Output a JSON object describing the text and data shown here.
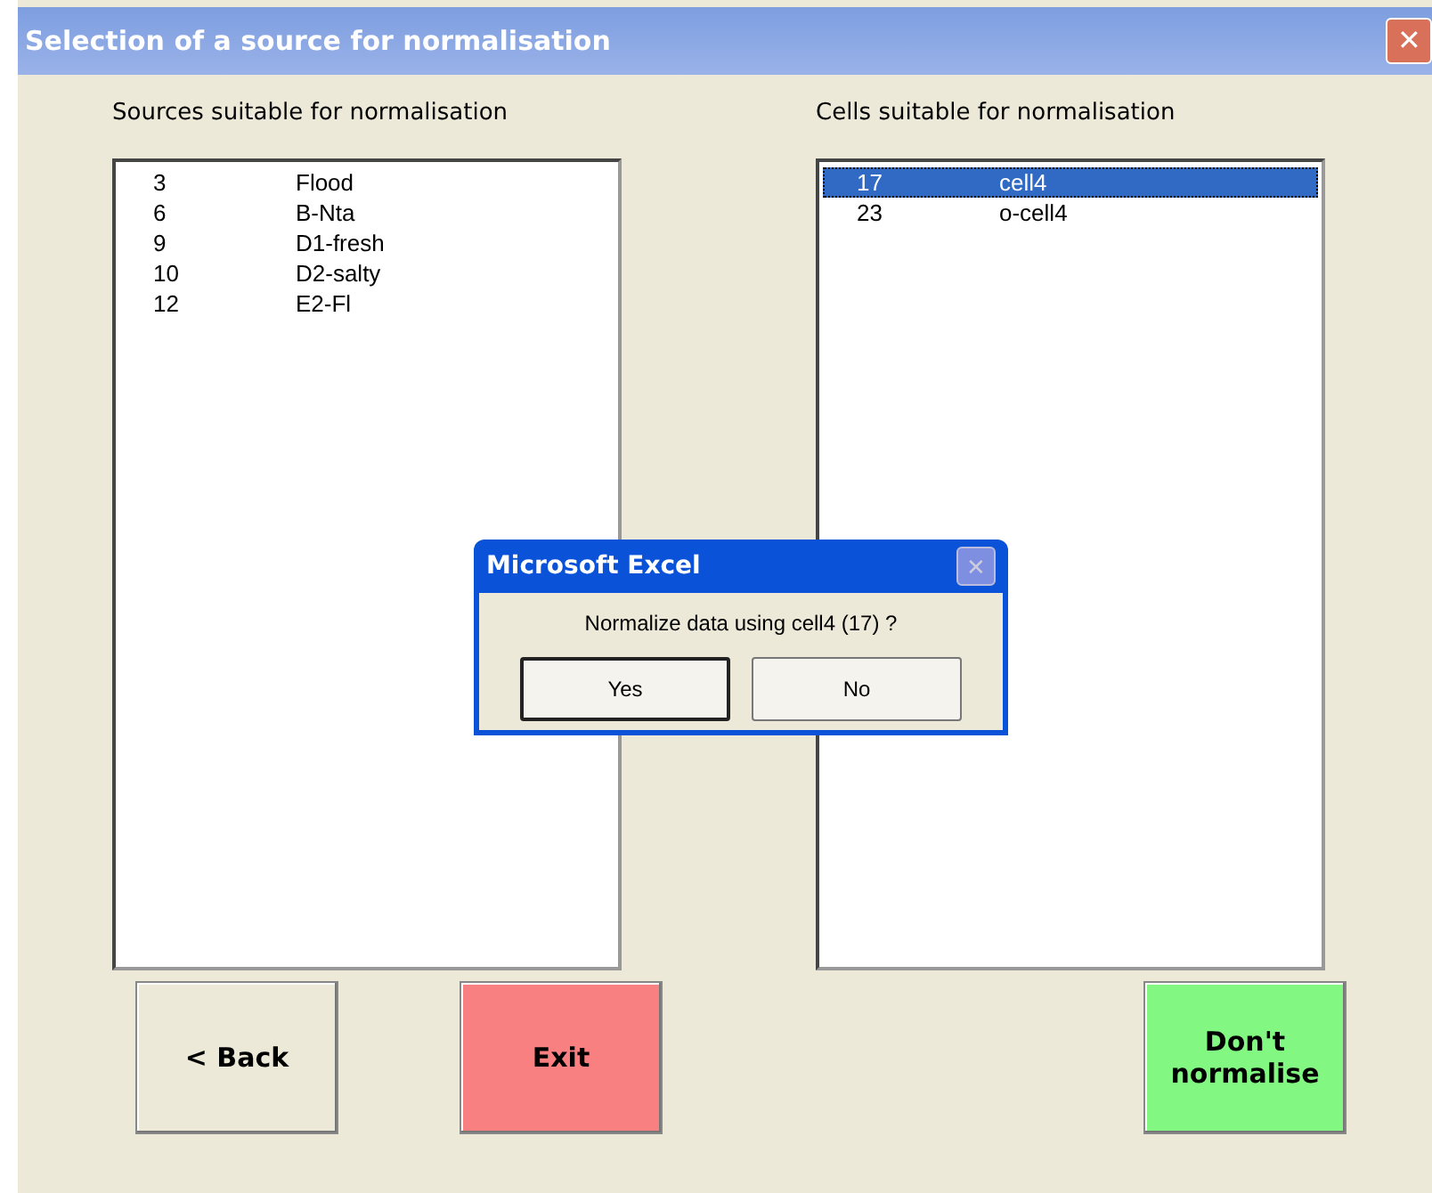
{
  "window": {
    "title": "Selection of a source for normalisation",
    "close": "✕"
  },
  "sources": {
    "label": "Sources suitable for normalisation",
    "rows": [
      {
        "id": "3",
        "name": "Flood",
        "selected": false
      },
      {
        "id": "6",
        "name": "B-Nta",
        "selected": false
      },
      {
        "id": "9",
        "name": "D1-fresh",
        "selected": false
      },
      {
        "id": "10",
        "name": "D2-salty",
        "selected": false
      },
      {
        "id": "12",
        "name": "E2-Fl",
        "selected": false
      }
    ]
  },
  "cells": {
    "label": "Cells suitable for normalisation",
    "rows": [
      {
        "id": "17",
        "name": "cell4",
        "selected": true
      },
      {
        "id": "23",
        "name": "o-cell4",
        "selected": false
      }
    ]
  },
  "buttons": [
    {
      "label": "< Back",
      "kind": "plain"
    },
    {
      "label": "Exit",
      "kind": "danger"
    },
    {
      "label": "Don't normalise",
      "kind": "go"
    }
  ],
  "dialog": {
    "title": "Microsoft Excel",
    "close": "✕",
    "message": "Normalize data using cell4  (17) ?",
    "buttons": [
      {
        "label": "Yes",
        "selected": true
      },
      {
        "label": "No",
        "selected": false
      }
    ]
  }
}
